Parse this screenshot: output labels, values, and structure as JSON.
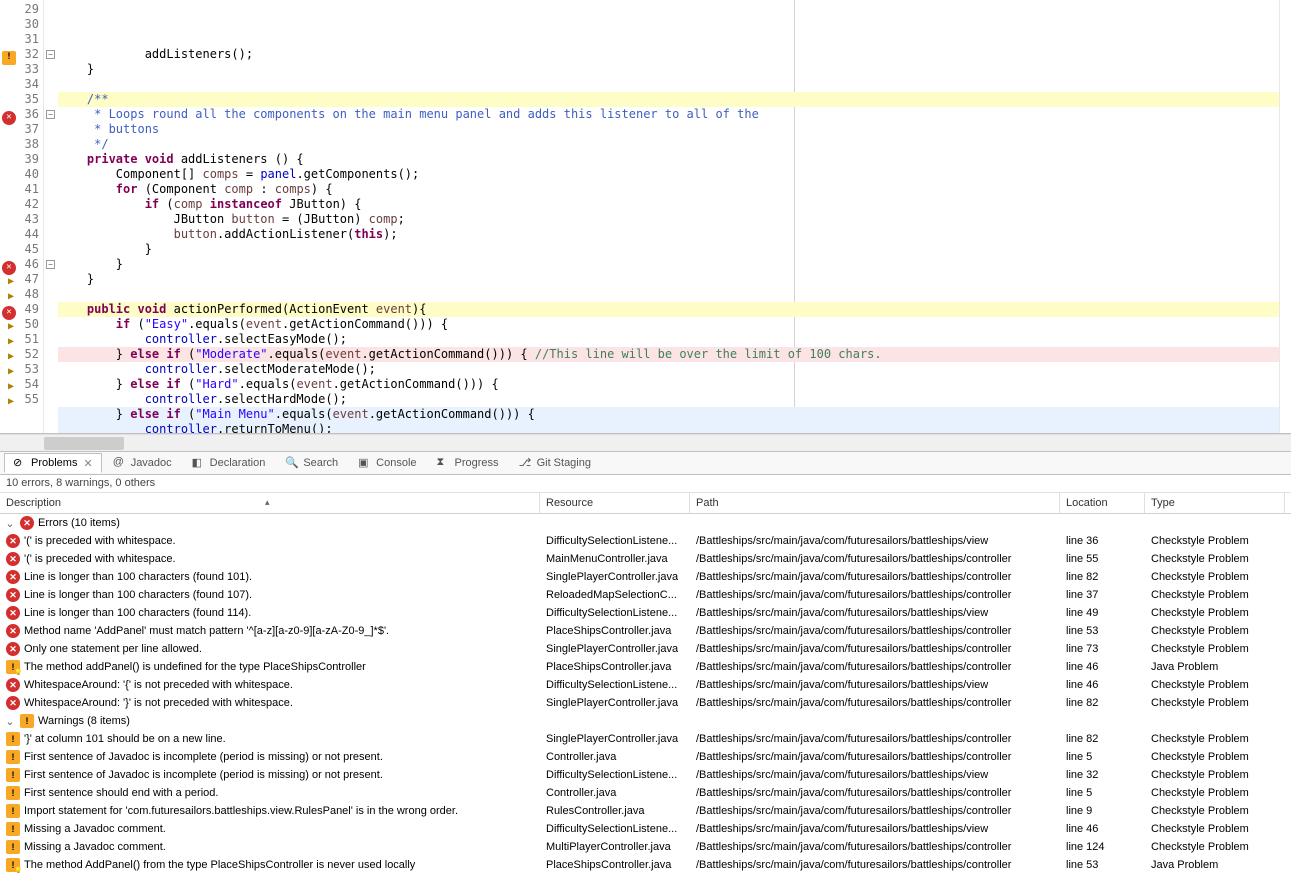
{
  "editor": {
    "startLine": 29,
    "lines": [
      {
        "n": 29,
        "html": "            addListeners();"
      },
      {
        "n": 30,
        "html": "    }"
      },
      {
        "n": 31,
        "html": ""
      },
      {
        "n": 32,
        "html": "    <span class='jdoc'>/**</span>",
        "marker": "warn",
        "fold": true,
        "bg": "hl-yellow"
      },
      {
        "n": 33,
        "html": "<span class='jdoc'>     * Loops round all the components on the main menu panel and adds this listener to all of the</span>"
      },
      {
        "n": 34,
        "html": "<span class='jdoc'>     * buttons</span>"
      },
      {
        "n": 35,
        "html": "<span class='jdoc'>     */</span>"
      },
      {
        "n": 36,
        "html": "    <span class='kw'>private void</span> addListeners () {",
        "marker": "err",
        "fold": true
      },
      {
        "n": 37,
        "html": "        Component[] <span class='param'>comps</span> = <span class='field'>panel</span>.getComponents();"
      },
      {
        "n": 38,
        "html": "        <span class='kw'>for</span> (Component <span class='param'>comp</span> : <span class='param'>comps</span>) {"
      },
      {
        "n": 39,
        "html": "            <span class='kw'>if</span> (<span class='param'>comp</span> <span class='kw'>instanceof</span> JButton) {"
      },
      {
        "n": 40,
        "html": "                JButton <span class='param'>button</span> = (JButton) <span class='param'>comp</span>;"
      },
      {
        "n": 41,
        "html": "                <span class='param'>button</span>.addActionListener(<span class='kw'>this</span>);"
      },
      {
        "n": 42,
        "html": "            }"
      },
      {
        "n": 43,
        "html": "        }"
      },
      {
        "n": 44,
        "html": "    }"
      },
      {
        "n": 45,
        "html": ""
      },
      {
        "n": 46,
        "html": "    <span class='kw'>public void</span> actionPerformed(ActionEvent <span class='param'>event</span>){",
        "marker": "err",
        "fold": true,
        "bg": "hl-yellow"
      },
      {
        "n": 47,
        "html": "        <span class='kw'>if</span> (<span class='str'>\"Easy\"</span>.equals(<span class='param'>event</span>.getActionCommand())) {",
        "marker": "arrow"
      },
      {
        "n": 48,
        "html": "            <span class='field'>controller</span>.selectEasyMode();",
        "marker": "arrow"
      },
      {
        "n": 49,
        "html": "        } <span class='kw'>else if</span> (<span class='str'>\"Moderate\"</span>.equals(<span class='param'>event</span>.getActionCommand())) { <span class='cmt'>//This line will be over the limit of 100 chars.</span>",
        "marker": "err",
        "bg": "hl-pink"
      },
      {
        "n": 50,
        "html": "            <span class='field'>controller</span>.selectModerateMode();",
        "marker": "arrow"
      },
      {
        "n": 51,
        "html": "        } <span class='kw'>else if</span> (<span class='str'>\"Hard\"</span>.equals(<span class='param'>event</span>.getActionCommand())) {",
        "marker": "arrow"
      },
      {
        "n": 52,
        "html": "            <span class='field'>controller</span>.selectHardMode();",
        "marker": "arrow"
      },
      {
        "n": 53,
        "html": "        } <span class='kw'>else if</span> (<span class='str'>\"Main Menu\"</span>.equals(<span class='param'>event</span>.getActionCommand())) {",
        "marker": "arrow",
        "bg": "hl-blue"
      },
      {
        "n": 54,
        "html": "            <span class='field'>controller</span>.returnToMenu();",
        "marker": "arrow",
        "bg": "hl-blue"
      },
      {
        "n": 55,
        "html": "        }",
        "marker": "arrow",
        "bg": "hl-blue"
      }
    ]
  },
  "tabs": [
    {
      "label": "Problems",
      "icon": "problems",
      "active": true,
      "closable": true
    },
    {
      "label": "Javadoc",
      "icon": "javadoc"
    },
    {
      "label": "Declaration",
      "icon": "declaration"
    },
    {
      "label": "Search",
      "icon": "search"
    },
    {
      "label": "Console",
      "icon": "console"
    },
    {
      "label": "Progress",
      "icon": "progress"
    },
    {
      "label": "Git Staging",
      "icon": "git"
    }
  ],
  "summary": "10 errors, 8 warnings, 0 others",
  "columns": {
    "desc": "Description",
    "res": "Resource",
    "path": "Path",
    "loc": "Location",
    "type": "Type"
  },
  "groups": [
    {
      "label": "Errors (10 items)",
      "icon": "err",
      "items": [
        {
          "icon": "err",
          "desc": "'(' is preceded with whitespace.",
          "res": "DifficultySelectionListene...",
          "path": "/Battleships/src/main/java/com/futuresailors/battleships/view",
          "loc": "line 36",
          "type": "Checkstyle Problem"
        },
        {
          "icon": "err",
          "desc": "'(' is preceded with whitespace.",
          "res": "MainMenuController.java",
          "path": "/Battleships/src/main/java/com/futuresailors/battleships/controller",
          "loc": "line 55",
          "type": "Checkstyle Problem"
        },
        {
          "icon": "err",
          "desc": "Line is longer than 100 characters (found 101).",
          "res": "SinglePlayerController.java",
          "path": "/Battleships/src/main/java/com/futuresailors/battleships/controller",
          "loc": "line 82",
          "type": "Checkstyle Problem"
        },
        {
          "icon": "err",
          "desc": "Line is longer than 100 characters (found 107).",
          "res": "ReloadedMapSelectionC...",
          "path": "/Battleships/src/main/java/com/futuresailors/battleships/controller",
          "loc": "line 37",
          "type": "Checkstyle Problem"
        },
        {
          "icon": "err",
          "desc": "Line is longer than 100 characters (found 114).",
          "res": "DifficultySelectionListene...",
          "path": "/Battleships/src/main/java/com/futuresailors/battleships/view",
          "loc": "line 49",
          "type": "Checkstyle Problem"
        },
        {
          "icon": "err",
          "desc": "Method name 'AddPanel' must match pattern '^[a-z][a-z0-9][a-zA-Z0-9_]*$'.",
          "res": "PlaceShipsController.java",
          "path": "/Battleships/src/main/java/com/futuresailors/battleships/controller",
          "loc": "line 53",
          "type": "Checkstyle Problem"
        },
        {
          "icon": "err",
          "desc": "Only one statement per line allowed.",
          "res": "SinglePlayerController.java",
          "path": "/Battleships/src/main/java/com/futuresailors/battleships/controller",
          "loc": "line 73",
          "type": "Checkstyle Problem"
        },
        {
          "icon": "qfix",
          "desc": "The method addPanel() is undefined for the type PlaceShipsController",
          "res": "PlaceShipsController.java",
          "path": "/Battleships/src/main/java/com/futuresailors/battleships/controller",
          "loc": "line 46",
          "type": "Java Problem"
        },
        {
          "icon": "err",
          "desc": "WhitespaceAround: '{' is not preceded with whitespace.",
          "res": "DifficultySelectionListene...",
          "path": "/Battleships/src/main/java/com/futuresailors/battleships/view",
          "loc": "line 46",
          "type": "Checkstyle Problem"
        },
        {
          "icon": "err",
          "desc": "WhitespaceAround: '}' is not preceded with whitespace.",
          "res": "SinglePlayerController.java",
          "path": "/Battleships/src/main/java/com/futuresailors/battleships/controller",
          "loc": "line 82",
          "type": "Checkstyle Problem"
        }
      ]
    },
    {
      "label": "Warnings (8 items)",
      "icon": "warn",
      "items": [
        {
          "icon": "warn",
          "desc": "'}' at column 101 should be on a new line.",
          "res": "SinglePlayerController.java",
          "path": "/Battleships/src/main/java/com/futuresailors/battleships/controller",
          "loc": "line 82",
          "type": "Checkstyle Problem"
        },
        {
          "icon": "warn",
          "desc": "First sentence of Javadoc is incomplete (period is missing) or not present.",
          "res": "Controller.java",
          "path": "/Battleships/src/main/java/com/futuresailors/battleships/controller",
          "loc": "line 5",
          "type": "Checkstyle Problem"
        },
        {
          "icon": "warn",
          "desc": "First sentence of Javadoc is incomplete (period is missing) or not present.",
          "res": "DifficultySelectionListene...",
          "path": "/Battleships/src/main/java/com/futuresailors/battleships/view",
          "loc": "line 32",
          "type": "Checkstyle Problem"
        },
        {
          "icon": "warn",
          "desc": "First sentence should end with a period.",
          "res": "Controller.java",
          "path": "/Battleships/src/main/java/com/futuresailors/battleships/controller",
          "loc": "line 5",
          "type": "Checkstyle Problem"
        },
        {
          "icon": "warn",
          "desc": "Import statement for 'com.futuresailors.battleships.view.RulesPanel' is in the wrong order.",
          "res": "RulesController.java",
          "path": "/Battleships/src/main/java/com/futuresailors/battleships/controller",
          "loc": "line 9",
          "type": "Checkstyle Problem"
        },
        {
          "icon": "warn",
          "desc": "Missing a Javadoc comment.",
          "res": "DifficultySelectionListene...",
          "path": "/Battleships/src/main/java/com/futuresailors/battleships/view",
          "loc": "line 46",
          "type": "Checkstyle Problem"
        },
        {
          "icon": "warn",
          "desc": "Missing a Javadoc comment.",
          "res": "MultiPlayerController.java",
          "path": "/Battleships/src/main/java/com/futuresailors/battleships/controller",
          "loc": "line 124",
          "type": "Checkstyle Problem"
        },
        {
          "icon": "qfix",
          "desc": "The method AddPanel() from the type PlaceShipsController is never used locally",
          "res": "PlaceShipsController.java",
          "path": "/Battleships/src/main/java/com/futuresailors/battleships/controller",
          "loc": "line 53",
          "type": "Java Problem"
        }
      ]
    }
  ]
}
